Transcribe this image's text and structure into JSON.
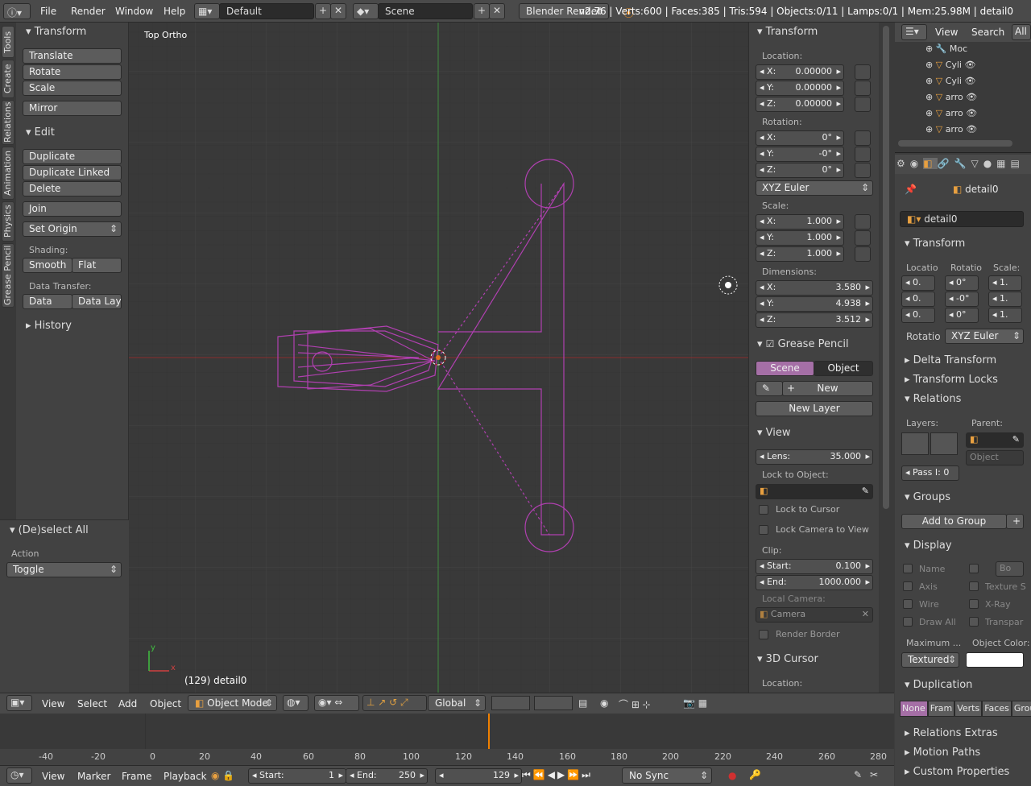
{
  "topbar": {
    "menus": [
      "File",
      "Render",
      "Window",
      "Help"
    ],
    "layout": "Default",
    "scene": "Scene",
    "engine": "Blender Render",
    "stats": "v2.76 | Verts:600 | Faces:385 | Tris:594 | Objects:0/11 | Lamps:0/1 | Mem:25.98M | detail0"
  },
  "toolshelf": {
    "tabs": [
      "Tools",
      "Create",
      "Relations",
      "Animation",
      "Physics",
      "Grease Pencil"
    ],
    "transform_header": "Transform",
    "translate": "Translate",
    "rotate": "Rotate",
    "scale": "Scale",
    "mirror": "Mirror",
    "edit_header": "Edit",
    "duplicate": "Duplicate",
    "duplicate_linked": "Duplicate Linked",
    "delete": "Delete",
    "join": "Join",
    "set_origin": "Set Origin",
    "shading_label": "Shading:",
    "smooth": "Smooth",
    "flat": "Flat",
    "data_transfer_label": "Data Transfer:",
    "data": "Data",
    "data_layout": "Data Layo",
    "history": "History",
    "op_header": "(De)select All",
    "action_label": "Action",
    "action_value": "Toggle"
  },
  "viewport": {
    "view_name": "Top Ortho",
    "object_label": "(129) detail0",
    "axis_x": "x",
    "axis_y": "y"
  },
  "npanel": {
    "transform": "Transform",
    "location": "Location:",
    "loc": [
      {
        "a": "X:",
        "v": "0.00000"
      },
      {
        "a": "Y:",
        "v": "0.00000"
      },
      {
        "a": "Z:",
        "v": "0.00000"
      }
    ],
    "rotation": "Rotation:",
    "rot": [
      {
        "a": "X:",
        "v": "0°"
      },
      {
        "a": "Y:",
        "v": "-0°"
      },
      {
        "a": "Z:",
        "v": "0°"
      }
    ],
    "rot_mode": "XYZ Euler",
    "scale": "Scale:",
    "scl": [
      {
        "a": "X:",
        "v": "1.000"
      },
      {
        "a": "Y:",
        "v": "1.000"
      },
      {
        "a": "Z:",
        "v": "1.000"
      }
    ],
    "dimensions": "Dimensions:",
    "dim": [
      {
        "a": "X:",
        "v": "3.580"
      },
      {
        "a": "Y:",
        "v": "4.938"
      },
      {
        "a": "Z:",
        "v": "3.512"
      }
    ],
    "grease_pencil": "Grease Pencil",
    "gp_scene": "Scene",
    "gp_object": "Object",
    "gp_new": "New",
    "gp_new_layer": "New Layer",
    "view": "View",
    "lens_label": "Lens:",
    "lens_value": "35.000",
    "lock_to_object": "Lock to Object:",
    "lock_to_cursor": "Lock to Cursor",
    "lock_camera": "Lock Camera to View",
    "clip": "Clip:",
    "clip_start_label": "Start:",
    "clip_start": "0.100",
    "clip_end_label": "End:",
    "clip_end": "1000.000",
    "local_camera": "Local Camera:",
    "camera": "Camera",
    "render_border": "Render Border",
    "cursor3d": "3D Cursor",
    "cursor_location": "Location:"
  },
  "outliner": {
    "view": "View",
    "search": "Search",
    "all": "All",
    "rows": [
      "Moc",
      "Cyli",
      "Cyli",
      "arro",
      "arro",
      "arro"
    ]
  },
  "props": {
    "object_name": "detail0",
    "object_field": "detail0",
    "transform": "Transform",
    "col_location": "Locatio",
    "col_rotation": "Rotatio",
    "col_scale": "Scale:",
    "loc_vals": [
      "0.",
      "0.",
      "0."
    ],
    "rot_vals": [
      "0°",
      "-0°",
      "0°"
    ],
    "scl_vals": [
      "1.",
      "1.",
      "1."
    ],
    "rot_label": "Rotatio",
    "rot_mode": "XYZ Euler",
    "delta": "Delta Transform",
    "locks": "Transform Locks",
    "relations": "Relations",
    "layers": "Layers:",
    "parent": "Parent:",
    "parent_type": "Object",
    "pass_index": "Pass I: 0",
    "groups": "Groups",
    "add_to_group": "Add to Group",
    "display": "Display",
    "d_name": "Name",
    "d_bo": "Bo",
    "d_axis": "Axis",
    "d_texture": "Texture S",
    "d_wire": "Wire",
    "d_xray": "X-Ray",
    "d_drawall": "Draw All",
    "d_transp": "Transpar",
    "maximum": "Maximum ...",
    "object_color": "Object Color:",
    "draw_type": "Textured",
    "duplication": "Duplication",
    "dup_opts": [
      "None",
      "Fram",
      "Verts",
      "Faces",
      "Group"
    ],
    "relations_extras": "Relations Extras",
    "motion_paths": "Motion Paths",
    "custom_props": "Custom Properties"
  },
  "header3d": {
    "view": "View",
    "select": "Select",
    "add": "Add",
    "object": "Object",
    "mode": "Object Mode",
    "orientation": "Global"
  },
  "timeline": {
    "ticks": [
      "-40",
      "-20",
      "0",
      "20",
      "40",
      "60",
      "80",
      "100",
      "120",
      "140",
      "160",
      "180",
      "200",
      "220",
      "240",
      "260",
      "280"
    ]
  },
  "footer": {
    "view": "View",
    "marker": "Marker",
    "frame": "Frame",
    "playback": "Playback",
    "start_label": "Start:",
    "start": "1",
    "end_label": "End:",
    "end": "250",
    "current": "129",
    "sync": "No Sync"
  },
  "colors": {
    "accent": "#a56fa6",
    "selection": "#c040c0",
    "cursor": "#f08000"
  }
}
